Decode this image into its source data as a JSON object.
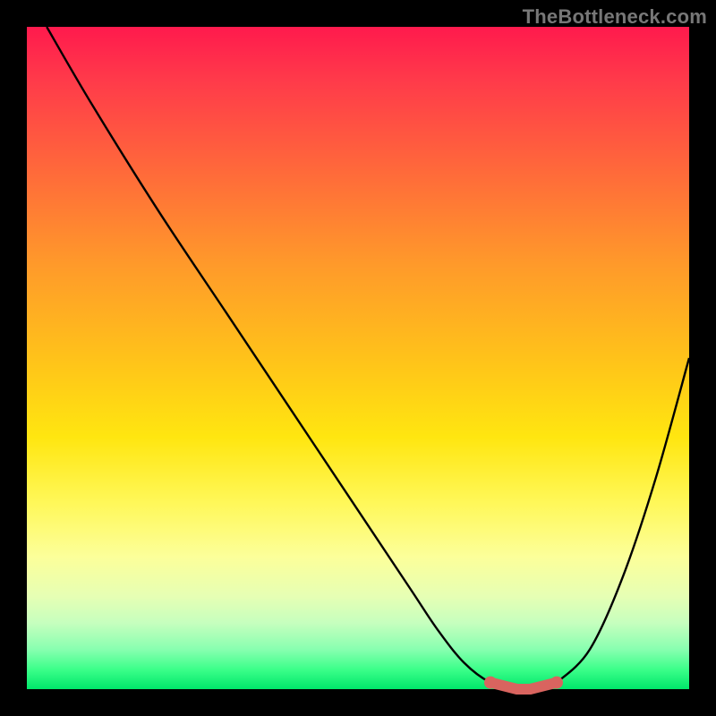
{
  "watermark": "TheBottleneck.com",
  "colors": {
    "background": "#000000",
    "gradient_top": "#ff1a4d",
    "gradient_bottom": "#00e66a",
    "curve": "#000000",
    "marker": "#d9645f"
  },
  "chart_data": {
    "type": "line",
    "title": "",
    "xlabel": "",
    "ylabel": "",
    "xlim": [
      0,
      100
    ],
    "ylim": [
      0,
      100
    ],
    "grid": false,
    "series": [
      {
        "name": "bottleneck-curve",
        "x": [
          3,
          10,
          20,
          30,
          40,
          50,
          58,
          62,
          66,
          70,
          74,
          78,
          80,
          85,
          90,
          95,
          100
        ],
        "y": [
          100,
          88,
          72,
          57,
          42,
          27,
          15,
          9,
          4,
          1,
          0,
          0,
          1,
          6,
          17,
          32,
          50
        ]
      }
    ],
    "markers": {
      "name": "flat-minimum-highlight",
      "x": [
        70,
        72,
        74,
        76,
        78,
        80
      ],
      "y": [
        1,
        0.5,
        0,
        0,
        0.5,
        1
      ]
    }
  }
}
